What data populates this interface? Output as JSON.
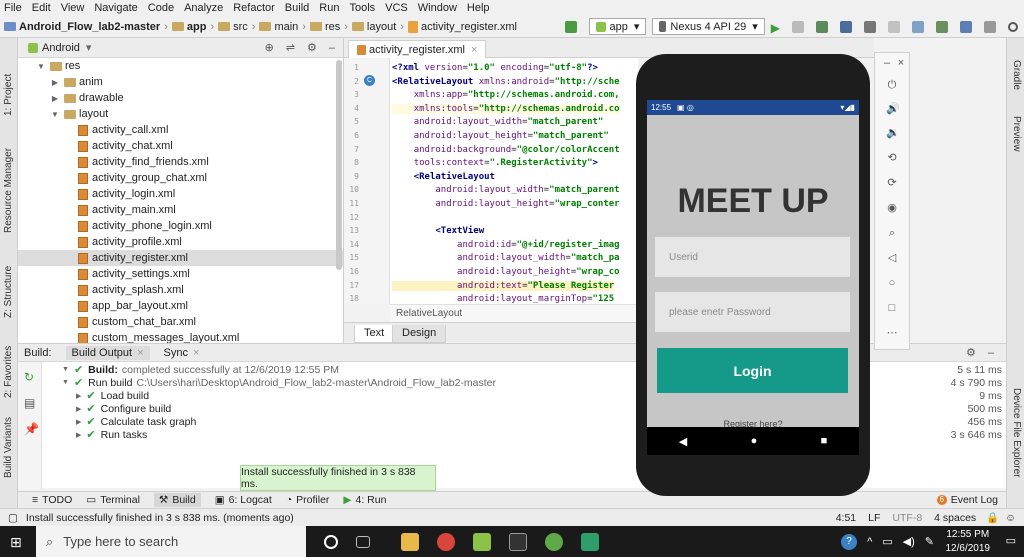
{
  "menu": [
    "File",
    "Edit",
    "View",
    "Navigate",
    "Code",
    "Analyze",
    "Refactor",
    "Build",
    "Run",
    "Tools",
    "VCS",
    "Window",
    "Help"
  ],
  "breadcrumb": [
    "Android_Flow_lab2-master",
    "app",
    "src",
    "main",
    "res",
    "layout",
    "activity_register.xml"
  ],
  "toolbar": {
    "run_config": "app",
    "device": "Nexus 4 API 29"
  },
  "project": {
    "view": "Android",
    "tree": [
      {
        "label": "res",
        "indent": 1,
        "arrow": "▼",
        "type": "folder"
      },
      {
        "label": "anim",
        "indent": 2,
        "arrow": "▶",
        "type": "folder"
      },
      {
        "label": "drawable",
        "indent": 2,
        "arrow": "▶",
        "type": "folder"
      },
      {
        "label": "layout",
        "indent": 2,
        "arrow": "▼",
        "type": "folder"
      },
      {
        "label": "activity_call.xml",
        "indent": 3,
        "type": "xml"
      },
      {
        "label": "activity_chat.xml",
        "indent": 3,
        "type": "xml"
      },
      {
        "label": "activity_find_friends.xml",
        "indent": 3,
        "type": "xml"
      },
      {
        "label": "activity_group_chat.xml",
        "indent": 3,
        "type": "xml"
      },
      {
        "label": "activity_login.xml",
        "indent": 3,
        "type": "xml"
      },
      {
        "label": "activity_main.xml",
        "indent": 3,
        "type": "xml"
      },
      {
        "label": "activity_phone_login.xml",
        "indent": 3,
        "type": "xml"
      },
      {
        "label": "activity_profile.xml",
        "indent": 3,
        "type": "xml"
      },
      {
        "label": "activity_register.xml",
        "indent": 3,
        "type": "xml",
        "selected": true
      },
      {
        "label": "activity_settings.xml",
        "indent": 3,
        "type": "xml"
      },
      {
        "label": "activity_splash.xml",
        "indent": 3,
        "type": "xml"
      },
      {
        "label": "app_bar_layout.xml",
        "indent": 3,
        "type": "xml"
      },
      {
        "label": "custom_chat_bar.xml",
        "indent": 3,
        "type": "xml"
      },
      {
        "label": "custom_messages_layout.xml",
        "indent": 3,
        "type": "xml"
      }
    ]
  },
  "editor": {
    "tab": "activity_register.xml",
    "breadcrumb": "RelativeLayout",
    "bottom_tabs": [
      "Text",
      "Design"
    ],
    "lines": [
      {
        "n": "1",
        "text": "<?xml version=\"1.0\" encoding=\"utf-8\"?>"
      },
      {
        "n": "2",
        "text": "<RelativeLayout xmlns:android=\"http://sche"
      },
      {
        "n": "3",
        "text": "    xmlns:app=\"http://schemas.android.com,"
      },
      {
        "n": "4",
        "text": "    xmlns:tools=\"http://schemas.android.co"
      },
      {
        "n": "5",
        "text": "    android:layout_width=\"match_parent\""
      },
      {
        "n": "6",
        "text": "    android:layout_height=\"match_parent\""
      },
      {
        "n": "7",
        "text": "    android:background=\"@color/colorAccent"
      },
      {
        "n": "8",
        "text": "    tools:context=\".RegisterActivity\">"
      },
      {
        "n": "9",
        "text": "    <RelativeLayout"
      },
      {
        "n": "10",
        "text": "        android:layout_width=\"match_parent"
      },
      {
        "n": "11",
        "text": "        android:layout_height=\"wrap_conter"
      },
      {
        "n": "12",
        "text": ""
      },
      {
        "n": "13",
        "text": "        <TextView"
      },
      {
        "n": "14",
        "text": "            android:id=\"@+id/register_imag"
      },
      {
        "n": "15",
        "text": "            android:layout_width=\"match_pa"
      },
      {
        "n": "16",
        "text": "            android:layout_height=\"wrap_co"
      },
      {
        "n": "17",
        "text": "            android:text=\"Please Register"
      },
      {
        "n": "18",
        "text": "            android:layout_marginTop=\"125"
      }
    ]
  },
  "build": {
    "tabs": [
      "Build:",
      "Build Output",
      "Sync"
    ],
    "rows": [
      {
        "label": "Build:",
        "detail": "completed successfully at 12/6/2019 12:55 PM",
        "duration": "5 s 11 ms"
      },
      {
        "label": "Run build",
        "detail": "C:\\Users\\hari\\Desktop\\Android_Flow_lab2-master\\Android_Flow_lab2-master",
        "duration": "4 s 790 ms"
      },
      {
        "label": "Load build",
        "detail": "",
        "duration": "9 ms"
      },
      {
        "label": "Configure build",
        "detail": "",
        "duration": "500 ms"
      },
      {
        "label": "Calculate task graph",
        "detail": "",
        "duration": "456 ms"
      },
      {
        "label": "Run tasks",
        "detail": "",
        "duration": "3 s 646 ms"
      }
    ]
  },
  "toast": "Install successfully finished in 3 s 838 ms.",
  "bottom_tabs": [
    "TODO",
    "Terminal",
    "Build",
    "6: Logcat",
    "Profiler",
    "4: Run"
  ],
  "event_log": "Event Log",
  "status": {
    "message": "Install successfully finished in 3 s 838 ms. (moments ago)",
    "position": "4:51",
    "line_sep": "LF",
    "encoding": "UTF-8",
    "indent": "4 spaces"
  },
  "side_labels": {
    "left": [
      "1: Project",
      "Resource Manager",
      "Z: Structure",
      "2: Favorites",
      "Build Variants"
    ],
    "right": [
      "Gradle",
      "Preview",
      "Device File Explorer"
    ]
  },
  "phone": {
    "time": "12:55",
    "title": "MEET UP",
    "userid_placeholder": "Userid",
    "password_placeholder": "please enetr Password",
    "login": "Login",
    "register_link": "Register here?"
  },
  "taskbar": {
    "search_placeholder": "Type here to search",
    "time": "12:55 PM",
    "date": "12/6/2019"
  },
  "colors": {
    "accent": "#159a8a",
    "statusbar": "#1f4a93",
    "success": "#2e9e41"
  }
}
